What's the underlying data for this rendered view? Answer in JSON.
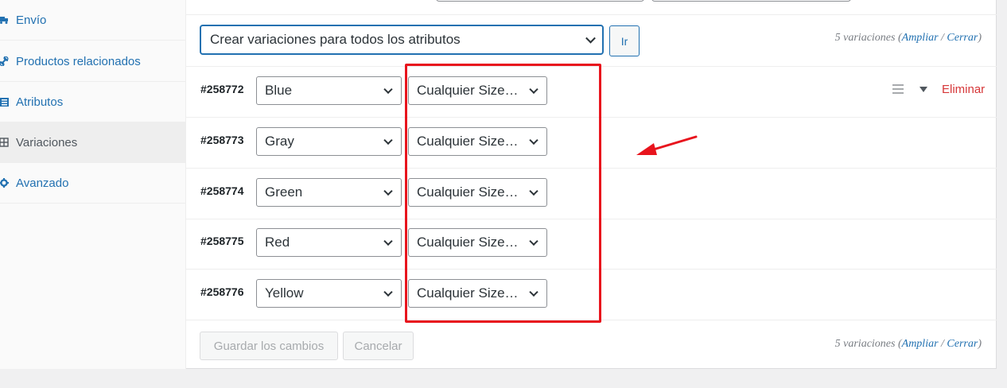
{
  "sidebar": {
    "items": [
      {
        "label": "Envío",
        "icon": "truck-icon",
        "active": false
      },
      {
        "label": "Productos relacionados",
        "icon": "link-icon",
        "active": false
      },
      {
        "label": "Atributos",
        "icon": "list-icon",
        "active": false
      },
      {
        "label": "Variaciones",
        "icon": "grid-icon",
        "active": true
      },
      {
        "label": "Avanzado",
        "icon": "gear-icon",
        "active": false
      }
    ]
  },
  "toolbar": {
    "bulk_action": "Crear variaciones para todos los atributos",
    "go_label": "Ir",
    "count_text": "5 variaciones",
    "expand_label": "Ampliar",
    "separator": "/",
    "collapse_label": "Cerrar"
  },
  "variations": [
    {
      "id": "#258772",
      "color": "Blue",
      "size": "Cualquier Size…"
    },
    {
      "id": "#258773",
      "color": "Gray",
      "size": "Cualquier Size…"
    },
    {
      "id": "#258774",
      "color": "Green",
      "size": "Cualquier Size…"
    },
    {
      "id": "#258775",
      "color": "Red",
      "size": "Cualquier Size…"
    },
    {
      "id": "#258776",
      "color": "Yellow",
      "size": "Cualquier Size…"
    }
  ],
  "row_actions": {
    "delete_label": "Eliminar"
  },
  "footer": {
    "save_label": "Guardar los cambios",
    "cancel_label": "Cancelar",
    "count_text": "5 variaciones",
    "expand_label": "Ampliar",
    "separator": "/",
    "collapse_label": "Cerrar"
  },
  "colors": {
    "accent": "#2271b1",
    "delete": "#d63638",
    "annotation": "#e8141d"
  }
}
